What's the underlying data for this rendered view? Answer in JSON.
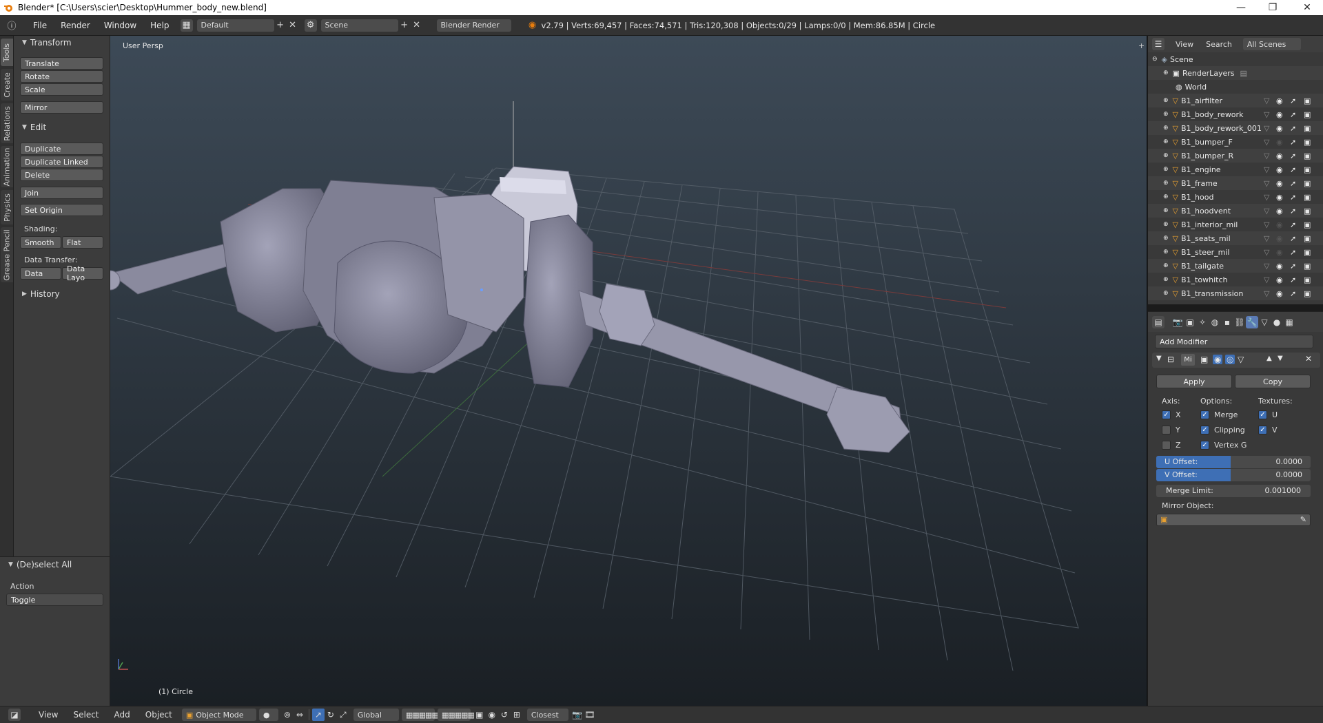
{
  "window": {
    "title": "Blender* [C:\\Users\\scier\\Desktop\\Hummer_body_new.blend]",
    "minimize": "—",
    "maximize": "❐",
    "close": "✕"
  },
  "menu": {
    "file": "File",
    "render": "Render",
    "window": "Window",
    "help": "Help"
  },
  "layout": {
    "name": "Default"
  },
  "scene": {
    "name": "Scene"
  },
  "engine": {
    "name": "Blender Render"
  },
  "stats": "v2.79 | Verts:69,457 | Faces:74,571 | Tris:120,308 | Objects:0/29 | Lamps:0/0 | Mem:86.85M | Circle",
  "tabs": [
    "Tools",
    "Create",
    "Relations",
    "Animation",
    "Physics",
    "Grease Pencil"
  ],
  "toolshelf": {
    "transform_header": "Transform",
    "translate": "Translate",
    "rotate": "Rotate",
    "scale": "Scale",
    "mirror": "Mirror",
    "edit_header": "Edit",
    "duplicate": "Duplicate",
    "duplicate_linked": "Duplicate Linked",
    "delete": "Delete",
    "join": "Join",
    "set_origin": "Set Origin",
    "shading_label": "Shading:",
    "smooth": "Smooth",
    "flat": "Flat",
    "data_transfer_label": "Data Transfer:",
    "data": "Data",
    "data_layout": "Data Layo",
    "history_header": "History"
  },
  "operator": {
    "header": "(De)select All",
    "action_label": "Action",
    "action_value": "Toggle"
  },
  "viewport": {
    "view_name": "User Persp",
    "object_name": "(1) Circle"
  },
  "outliner": {
    "view": "View",
    "search": "Search",
    "filter": "All Scenes",
    "scene": "Scene",
    "render_layers": "RenderLayers",
    "world": "World",
    "objects": [
      "B1_airfilter",
      "B1_body_rework",
      "B1_body_rework_001",
      "B1_bumper_F",
      "B1_bumper_R",
      "B1_engine",
      "B1_frame",
      "B1_hood",
      "B1_hoodvent",
      "B1_interior_mil",
      "B1_seats_mil",
      "B1_steer_mil",
      "B1_tailgate",
      "B1_towhitch",
      "B1_transmission"
    ]
  },
  "properties": {
    "add_modifier": "Add Modifier",
    "mod_name": "Mi",
    "apply": "Apply",
    "copy": "Copy",
    "axis_label": "Axis:",
    "options_label": "Options:",
    "textures_label": "Textures:",
    "x": "X",
    "y": "Y",
    "z": "Z",
    "merge": "Merge",
    "clipping": "Clipping",
    "vertex_groups": "Vertex G",
    "u": "U",
    "v": "V",
    "u_offset_label": "U Offset:",
    "u_offset": "0.0000",
    "v_offset_label": "V Offset:",
    "v_offset": "0.0000",
    "merge_limit_label": "Merge Limit:",
    "merge_limit": "0.001000",
    "mirror_object_label": "Mirror Object:"
  },
  "bottom": {
    "view": "View",
    "select": "Select",
    "add": "Add",
    "object": "Object",
    "mode": "Object Mode",
    "orientation": "Global",
    "snap": "Closest"
  },
  "colors": {
    "accent": "#3e6fb5",
    "viewport_top": "#3d4a57",
    "viewport_bottom": "#1a1f24",
    "mesh": "#8f8fa6"
  }
}
